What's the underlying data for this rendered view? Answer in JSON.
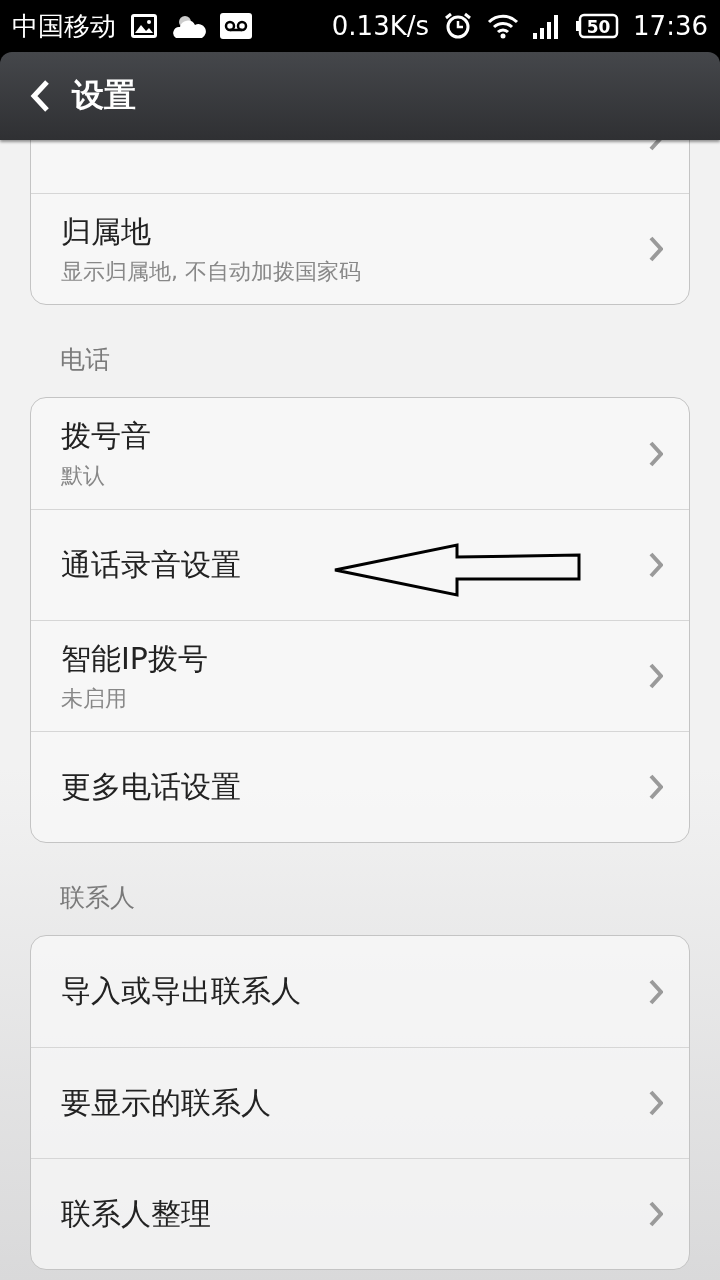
{
  "status_bar": {
    "carrier": "中国移动",
    "net_speed": "0.13K/s",
    "battery": "50",
    "time": "17:36"
  },
  "header": {
    "title": "设置"
  },
  "sections": [
    {
      "rows": [
        {
          "annotated": false
        },
        {
          "title": "归属地",
          "subtitle": "显示归属地, 不自动加拨国家码",
          "annotated": false
        }
      ]
    },
    {
      "title": "电话",
      "rows": [
        {
          "title": "拨号音",
          "subtitle": "默认",
          "annotated": false
        },
        {
          "title": "通话录音设置",
          "annotated": true
        },
        {
          "title": "智能IP拨号",
          "subtitle": "未启用",
          "annotated": false
        },
        {
          "title": "更多电话设置",
          "annotated": false
        }
      ]
    },
    {
      "title": "联系人",
      "rows": [
        {
          "title": "导入或导出联系人",
          "annotated": false
        },
        {
          "title": "要显示的联系人",
          "annotated": false
        },
        {
          "title": "联系人整理",
          "annotated": false
        }
      ]
    }
  ]
}
